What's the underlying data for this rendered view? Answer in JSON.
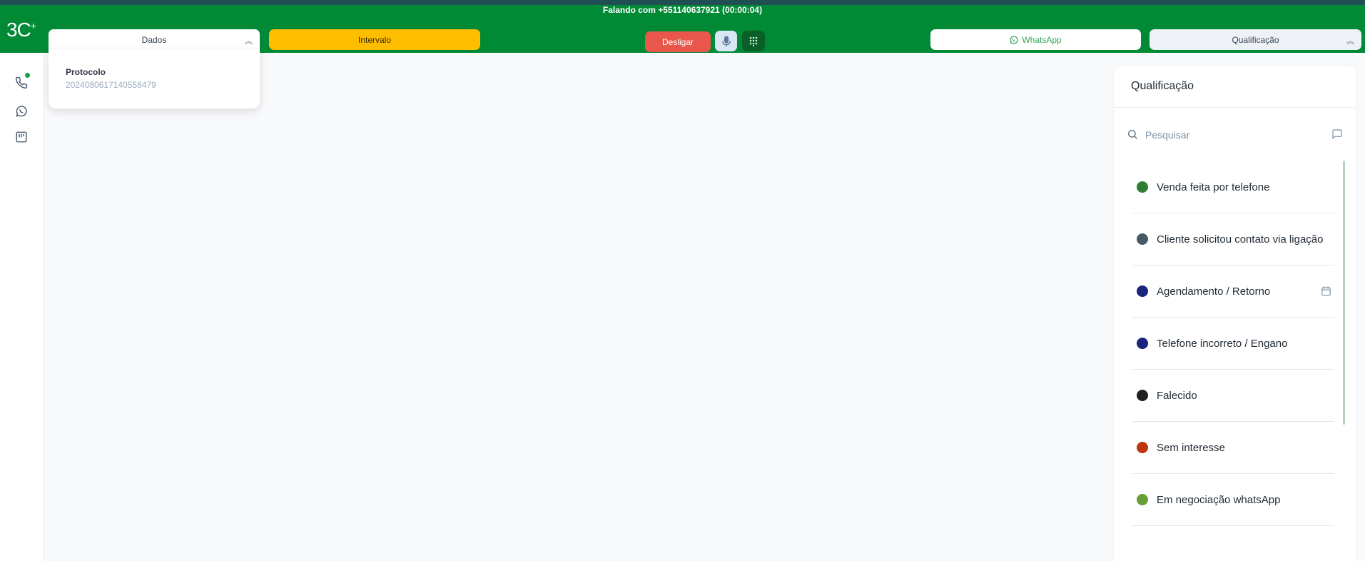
{
  "header": {
    "call_status_prefix": "Falando com +551140637921",
    "call_timer": "(00:00:04)",
    "logo_text": "3C",
    "logo_sup": "+"
  },
  "toolbar": {
    "dados_label": "Dados",
    "intervalo_label": "Intervalo",
    "desligar_label": "Desligar",
    "whatsapp_label": "WhatsApp",
    "qualificacao_label": "Qualificação"
  },
  "dados_panel": {
    "protocol_label": "Protocolo",
    "protocol_value": "20240806171405584​79"
  },
  "qualification": {
    "title": "Qualificação",
    "search_placeholder": "Pesquisar",
    "items": [
      {
        "label": "Venda feita por telefone",
        "color": "#2e7d32"
      },
      {
        "label": "Cliente solicitou contato via ligação",
        "color": "#455a64"
      },
      {
        "label": "Agendamento / Retorno",
        "color": "#1a237e",
        "icon": "calendar-icon"
      },
      {
        "label": "Telefone incorreto / Engano",
        "color": "#1a237e"
      },
      {
        "label": "Falecido",
        "color": "#212121"
      },
      {
        "label": "Sem interesse",
        "color": "#bf360c"
      },
      {
        "label": "Em negociação whatsApp",
        "color": "#689f38"
      }
    ]
  },
  "colors": {
    "topbar": "#008a35",
    "intervalo": "#ffbd00",
    "desligar": "#e9574c"
  }
}
